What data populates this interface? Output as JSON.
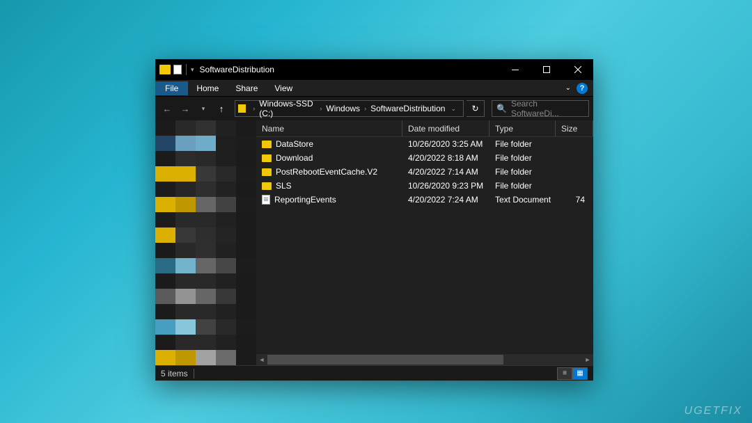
{
  "titlebar": {
    "title": "SoftwareDistribution"
  },
  "ribbon": {
    "file": "File",
    "tabs": [
      "Home",
      "Share",
      "View"
    ]
  },
  "breadcrumbs": [
    "Windows-SSD (C:)",
    "Windows",
    "SoftwareDistribution"
  ],
  "search": {
    "placeholder": "Search SoftwareDi..."
  },
  "columns": {
    "name": "Name",
    "date": "Date modified",
    "type": "Type",
    "size": "Size"
  },
  "items": [
    {
      "icon": "folder",
      "name": "DataStore",
      "date": "10/26/2020 3:25 AM",
      "type": "File folder",
      "size": ""
    },
    {
      "icon": "folder",
      "name": "Download",
      "date": "4/20/2022 8:18 AM",
      "type": "File folder",
      "size": ""
    },
    {
      "icon": "folder",
      "name": "PostRebootEventCache.V2",
      "date": "4/20/2022 7:14 AM",
      "type": "File folder",
      "size": ""
    },
    {
      "icon": "folder",
      "name": "SLS",
      "date": "10/26/2020 9:23 PM",
      "type": "File folder",
      "size": ""
    },
    {
      "icon": "file",
      "name": "ReportingEvents",
      "date": "4/20/2022 7:24 AM",
      "type": "Text Document",
      "size": "74"
    }
  ],
  "status": {
    "count": "5 items"
  },
  "watermark": "UGETFIX",
  "sidebar_pixels": [
    "#1b1b1b",
    "#2a2a2a",
    "#333",
    "#222",
    "#1b1b1b",
    "#24496b",
    "#6fa8c7",
    "#74b4d4",
    "#1f1f1f",
    "#1c1c1c",
    "#1b1b1b",
    "#2d2d2d",
    "#2a2a2a",
    "#202020",
    "#1b1b1b",
    "#e6b800",
    "#e6b800",
    "#3a3a3a",
    "#2a2a2a",
    "#1c1c1c",
    "#1c1c1c",
    "#272727",
    "#2f2f2f",
    "#232323",
    "#1b1b1b",
    "#e6b800",
    "#c79e00",
    "#6a6a6a",
    "#454545",
    "#1c1c1c",
    "#1c1c1c",
    "#2a2a2a",
    "#2a2a2a",
    "#222",
    "#1b1b1b",
    "#e6b800",
    "#3a3a3a",
    "#2f2f2f",
    "#252525",
    "#1b1b1b",
    "#1b1b1b",
    "#2a2a2a",
    "#303030",
    "#222",
    "#1b1b1b",
    "#2a6f8a",
    "#78bcd6",
    "#6a6a6a",
    "#4a4a4a",
    "#1c1c1c",
    "#1b1b1b",
    "#2a2a2a",
    "#2a2a2a",
    "#222",
    "#1b1b1b",
    "#5e5e5e",
    "#9a9a9a",
    "#6a6a6a",
    "#3a3a3a",
    "#1b1b1b",
    "#1b1b1b",
    "#2a2a2a",
    "#2a2a2a",
    "#222",
    "#1b1b1b",
    "#4aa5c9",
    "#8ed0e6",
    "#454545",
    "#2a2a2a",
    "#1c1c1c",
    "#1b1b1b",
    "#2a2a2a",
    "#2a2a2a",
    "#222",
    "#1b1b1b",
    "#e6b800",
    "#c79e00",
    "#aaa",
    "#707070",
    "#1b1b1b",
    "#1b1b1b",
    "#2a2a2a",
    "#2a2a2a",
    "#222",
    "#1b1b1b",
    "#1b1b1b",
    "#232323",
    "#232323",
    "#1f1f1f",
    "#1b1b1b"
  ]
}
